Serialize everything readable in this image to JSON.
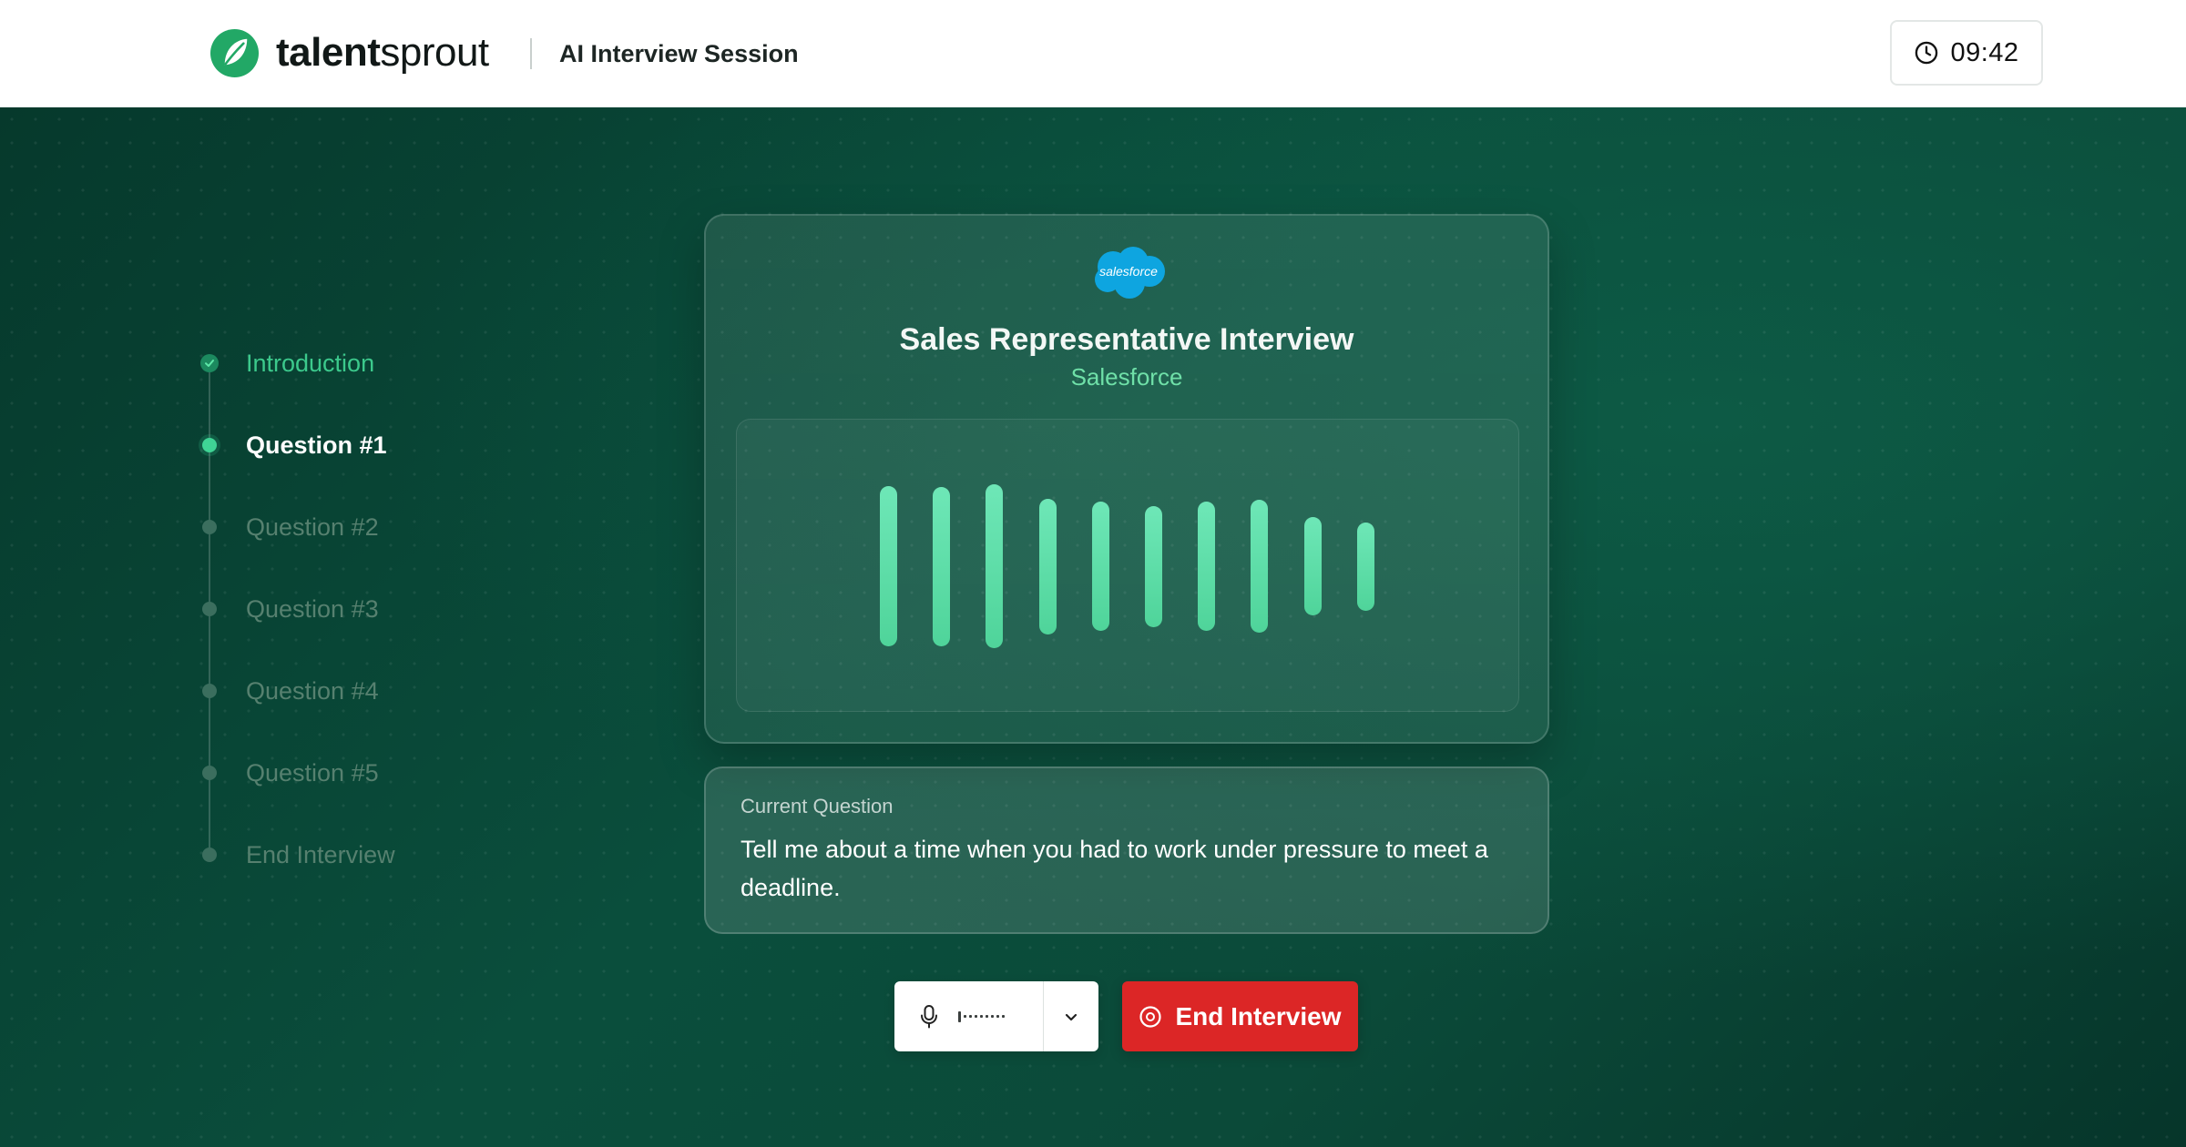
{
  "header": {
    "brand_bold": "talent",
    "brand_light": "sprout",
    "session_title": "AI Interview Session",
    "timer": "09:42",
    "logo_icon": "leaf-icon",
    "timer_icon": "clock-icon"
  },
  "stepper": {
    "steps": [
      {
        "label": "Introduction",
        "state": "done"
      },
      {
        "label": "Question #1",
        "state": "active"
      },
      {
        "label": "Question #2",
        "state": "todo"
      },
      {
        "label": "Question #3",
        "state": "todo"
      },
      {
        "label": "Question #4",
        "state": "todo"
      },
      {
        "label": "Question #5",
        "state": "todo"
      },
      {
        "label": "End Interview",
        "state": "todo"
      }
    ]
  },
  "interview": {
    "company_logo_text": "salesforce",
    "title": "Sales Representative Interview",
    "company": "Salesforce",
    "audio_levels": [
      0.98,
      0.97,
      1.0,
      0.83,
      0.79,
      0.74,
      0.79,
      0.81,
      0.6,
      0.54
    ]
  },
  "question": {
    "label": "Current Question",
    "text": "Tell me about a time when you had to work under pressure to meet a deadline."
  },
  "controls": {
    "mic_icon": "microphone-icon",
    "dropdown_icon": "chevron-down-icon",
    "end_label": "End Interview",
    "end_icon": "stop-circle-icon"
  },
  "colors": {
    "accent": "#3fd495",
    "danger": "#dc2626",
    "background": "#0a4e3c"
  }
}
